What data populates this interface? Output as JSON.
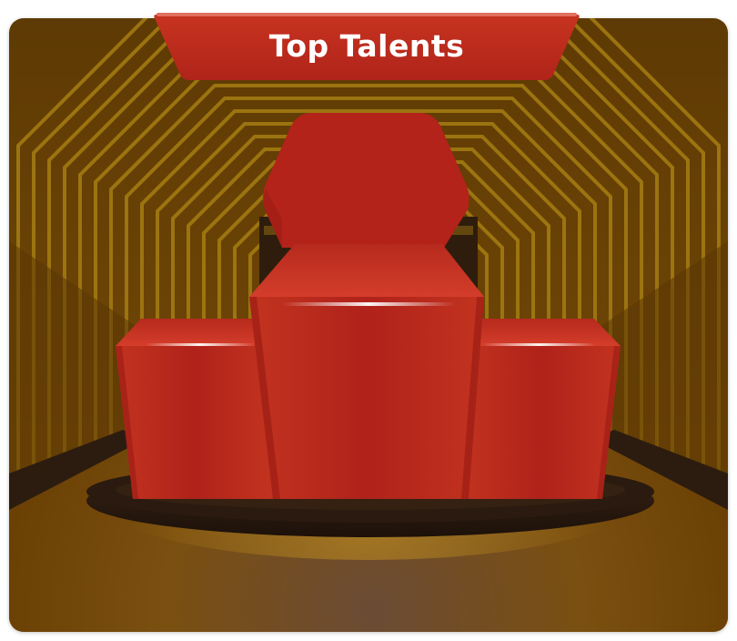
{
  "title": "Top Talents",
  "colors": {
    "banner_red": "#b5281b",
    "podium_red": "#b3231a",
    "tunnel_brown": "#6e4304",
    "tunnel_gold": "#a87c10",
    "floor_center": "#6a4a32",
    "stage_dark": "#2a1a10"
  },
  "icons": {
    "podium": "podium-icon"
  }
}
